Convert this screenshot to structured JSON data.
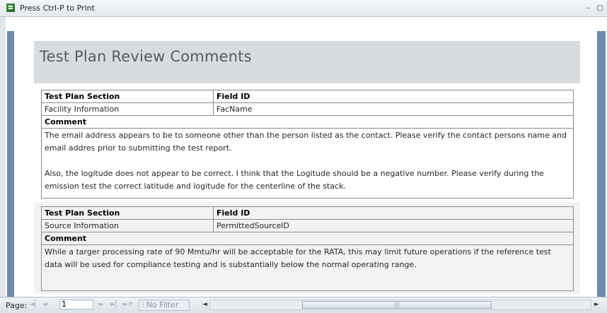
{
  "window": {
    "title": "Press Ctrl-P to Print",
    "minimize_icon": "minimize-icon",
    "restore_icon": "restore-icon"
  },
  "report": {
    "title": "Test Plan Review Comments"
  },
  "labels": {
    "section_header": "Test Plan Section",
    "field_header": "Field ID",
    "comment_header": "Comment"
  },
  "records": [
    {
      "section": "Facility Information",
      "field_id": "FacName",
      "comment": "The email address appears to be to someone other than the person listed as the contact. Please verify the contact persons name and email addres prior to submitting the test report.\n\nAlso, the logitude does not appear to be correct. I think that the Logitude should be a negative number. Please verify during the emission test the correct latitude and logitude for the centerline of the stack."
    },
    {
      "section": "Source Information",
      "field_id": "PermittedSourceID",
      "comment": "While a targer processing rate of 90 Mmtu/hr will be acceptable for the RATA, this may limit future operations if the reference test data will be used for compliance testing and is substantially below the normal operating range."
    }
  ],
  "navigation": {
    "page_label": "Page:",
    "first_icon": "first-page-icon",
    "prev_icon": "previous-page-icon",
    "current_page": "1",
    "next_icon": "next-page-icon",
    "last_icon": "last-page-icon",
    "new_icon": "new-record-icon",
    "filter_label": "No Filter",
    "filter_icon": "filter-icon"
  },
  "colors": {
    "header_band": "#d9dcdf",
    "frame": "#6e8aac",
    "alt_record": "#f2f2f2"
  }
}
